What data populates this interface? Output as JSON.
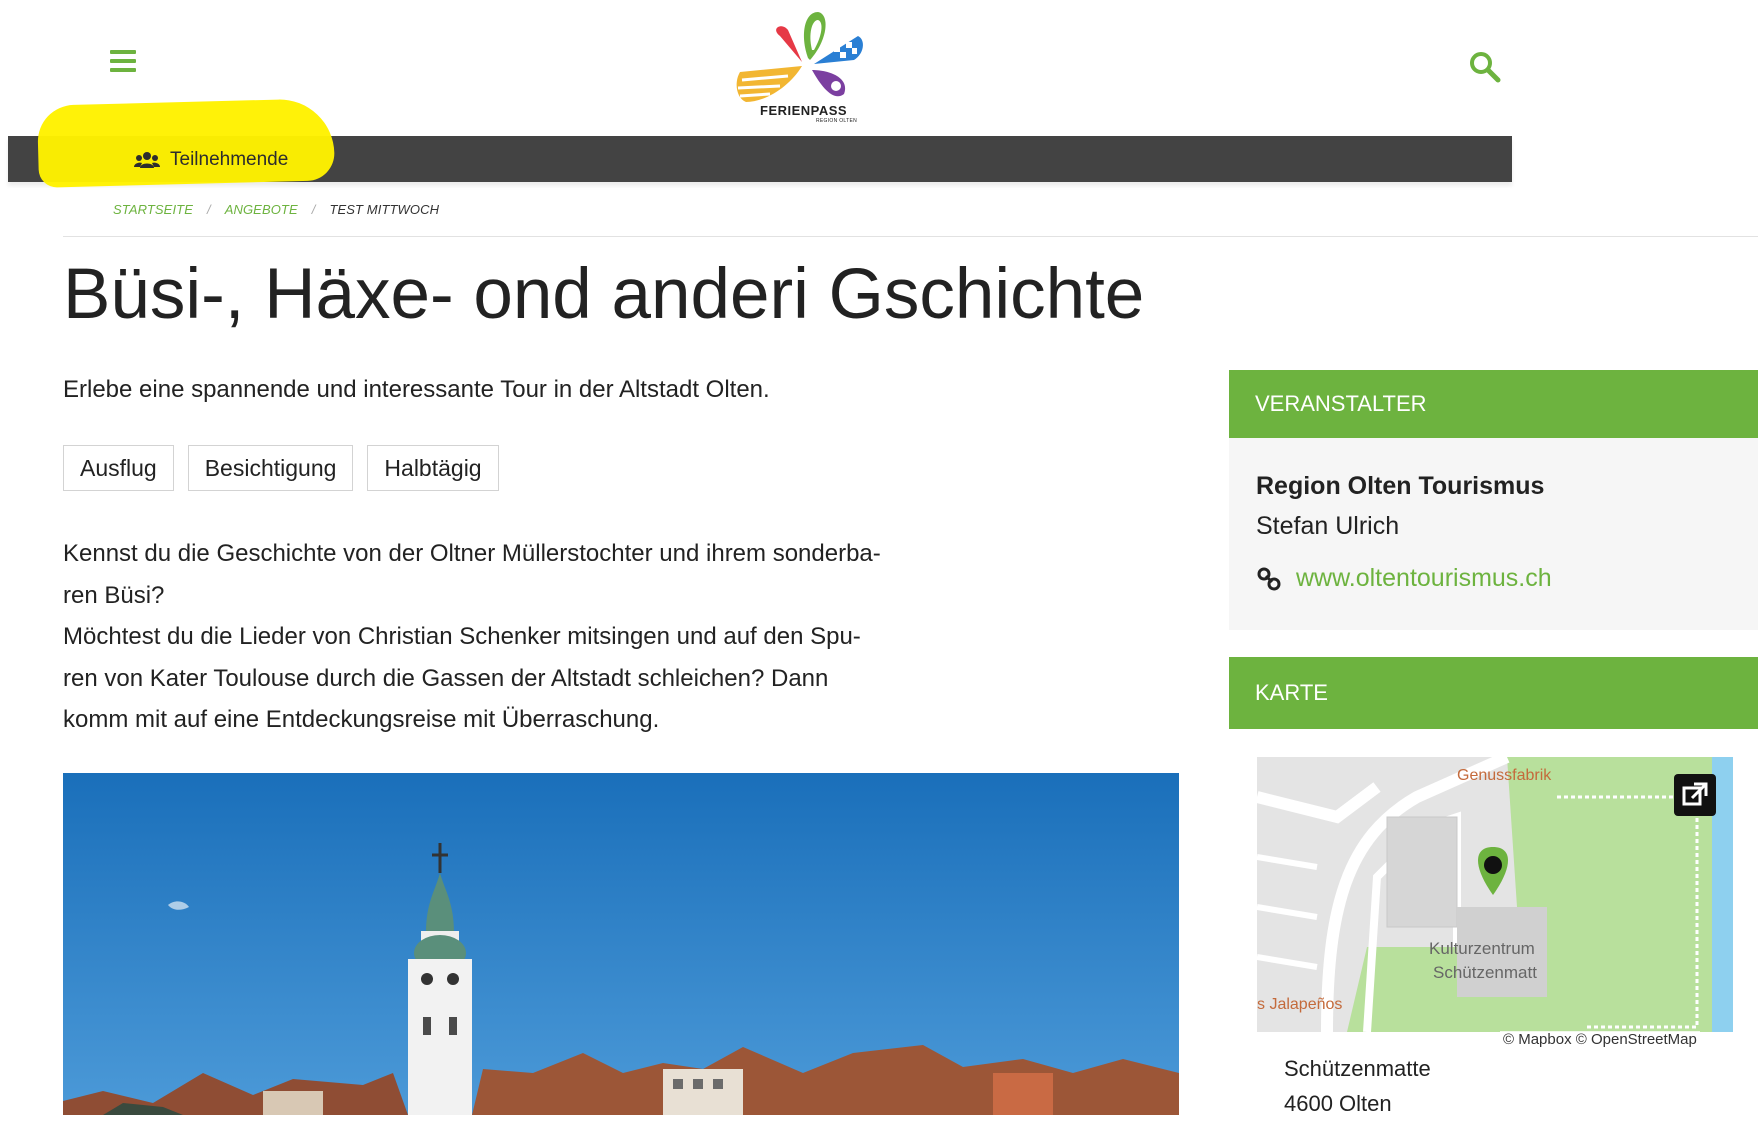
{
  "header": {
    "logo_text": "FERIENPASS",
    "logo_subtext": "REGION OLTEN",
    "menu_icon": "hamburger-menu-icon",
    "search_icon": "search-icon"
  },
  "nav": {
    "participants_label": "Teilnehmende",
    "participants_icon": "users-icon"
  },
  "breadcrumb": {
    "items": [
      "STARTSEITE",
      "ANGEBOTE"
    ],
    "current": "TEST MITTWOCH"
  },
  "offer": {
    "title": "Büsi-, Häxe- ond anderi Gschichte",
    "lead": "Erlebe eine spannende und interessante Tour in der Altstadt Olten.",
    "tags": [
      "Ausflug",
      "Besichtigung",
      "Halbtägig"
    ],
    "description_lines": [
      "Kennst du die Geschichte von der Oltner Müllerstochter und ihrem sonderba-",
      "ren Büsi?",
      "Möchtest du die Lieder von Christian Schenker mitsingen und auf den Spu-",
      "ren von Kater Toulouse durch die Gassen der Altstadt schleichen? Dann",
      "komm mit auf eine Entdeckungsreise mit Überraschung."
    ]
  },
  "organizer": {
    "heading": "VERANSTALTER",
    "name": "Region Olten Tourismus",
    "person": "Stefan Ulrich",
    "website": "www.oltentourismus.ch",
    "link_icon": "link-icon"
  },
  "map": {
    "heading": "KARTE",
    "labels": [
      "Genussfabrik",
      "Kulturzentrum",
      "Schützenmatt",
      "s Jalapeños"
    ],
    "attribution": "© Mapbox © OpenStreetMap",
    "address_line1": "Schützenmatte",
    "address_line2": "4600 Olten"
  },
  "colors": {
    "accent_green": "#6db33f",
    "nav_dark": "#434343",
    "highlight_yellow": "#fff200",
    "sky_blue": "#1f78c2"
  }
}
